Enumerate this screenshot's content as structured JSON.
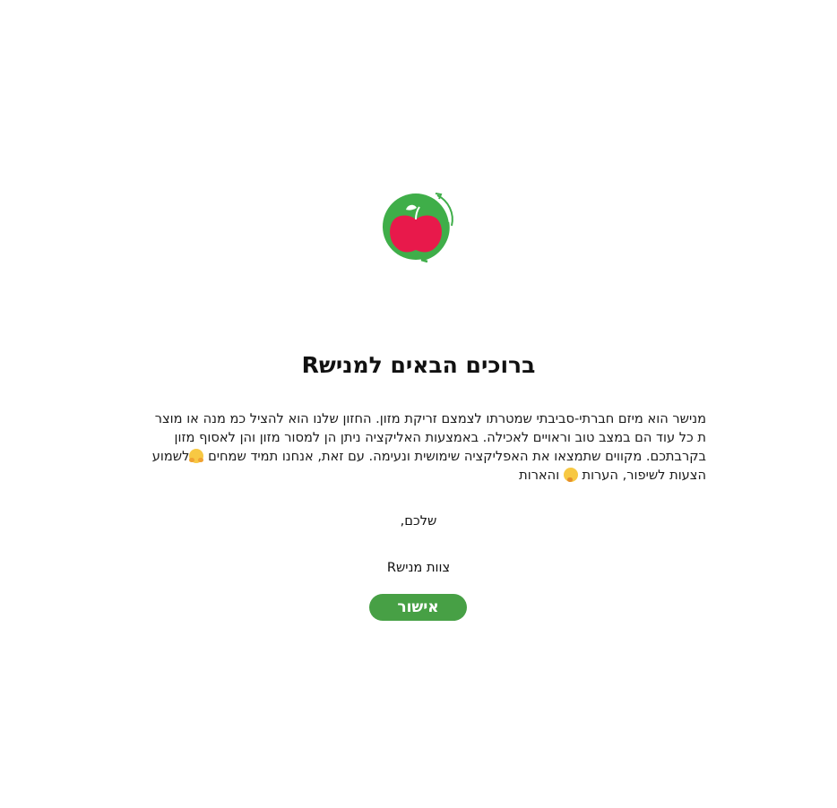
{
  "welcome": {
    "title": "ברוכים הבאים למנישR",
    "paragraph": "מנישר הוא מיזם חברתי-סביבתי שמטרתו לצמצם זריקת מזון. החזון שלנו הוא להציל כמ מנה או מוצר ת כל עוד הם במצב טוב וראויים לאכילה. באמצעות האליקציה ניתן הן למסור מזון והן לאסוף מזון בקרבתכם. מקווים שתמצאו את האפליקציה שימושית ונעימה. עם זאת, אנחנו תמיד שמחים",
    "paragraph_end": "לשמוע הצעות לשיפור, הערות",
    "paragraph_tail": "והארות",
    "signoff": "שלכם,",
    "team": "צוות מנישR",
    "confirm_label": "אישור"
  },
  "colors": {
    "brand_green": "#47a045",
    "apple_red": "#e8194b",
    "logo_green": "#3fae49"
  },
  "icons": {
    "logo": "apple-logo-icon",
    "emoji_hug": "hugging-face-icon",
    "emoji_think": "thinking-face-icon"
  }
}
